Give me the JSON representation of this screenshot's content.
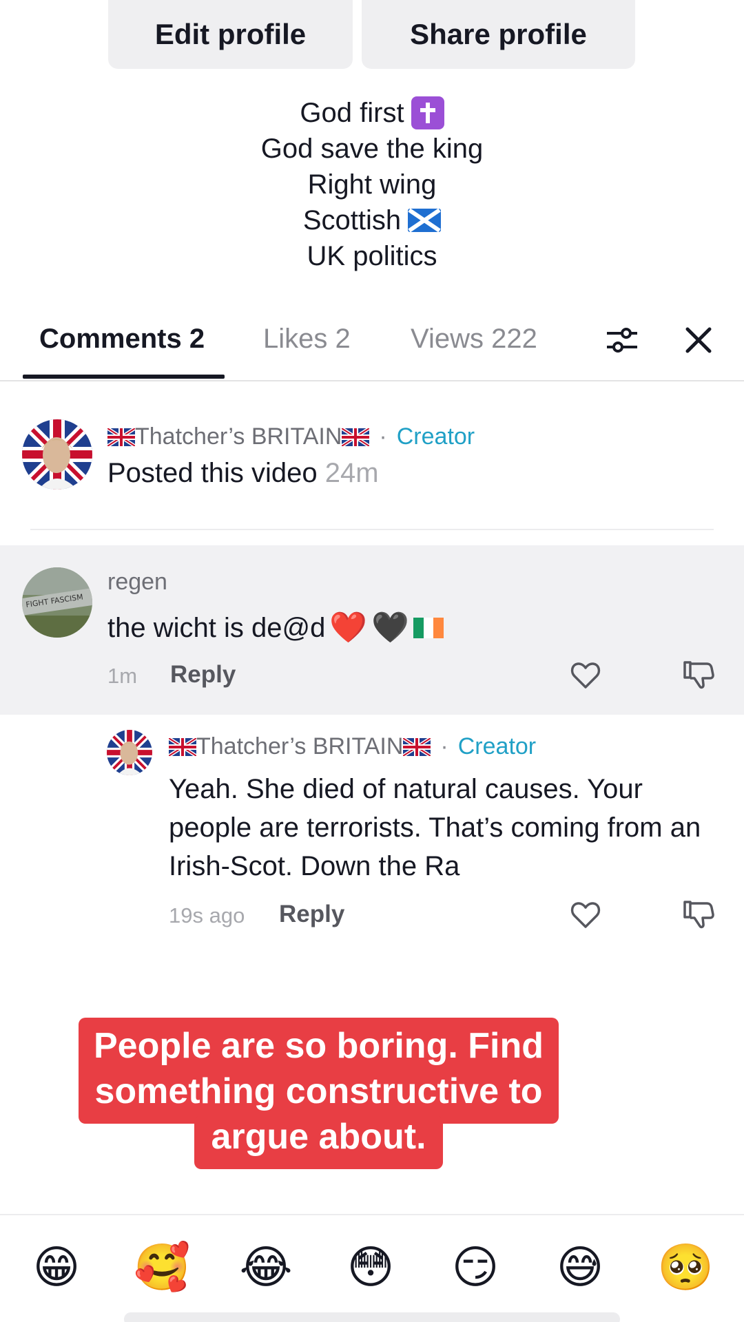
{
  "profile": {
    "edit_label": "Edit profile",
    "share_label": "Share profile",
    "bio_lines": [
      "God first",
      "God save the king",
      "Right wing",
      "Scottish",
      "UK politics"
    ]
  },
  "tabs": [
    {
      "label": "Comments 2",
      "active": true
    },
    {
      "label": "Likes 2",
      "active": false
    },
    {
      "label": "Views 222",
      "active": false
    }
  ],
  "post": {
    "author": "Thatcher’s BRITAIN",
    "creator_label": "Creator",
    "dot": "·",
    "text": "Posted this video",
    "time": "24m"
  },
  "comment": {
    "username": "regen",
    "text": "the wicht is de@d",
    "emojis": [
      "❤️",
      "🖤"
    ],
    "time": "1m",
    "reply_label": "Reply"
  },
  "reply": {
    "author": "Thatcher’s BRITAIN",
    "creator_label": "Creator",
    "dot": "·",
    "text": "Yeah. She died of natural causes. Your people are terrorists. That’s coming from an Irish-Scot. Down the Ra",
    "time": "19s ago",
    "reply_label": "Reply"
  },
  "caption": {
    "text": "People are so boring. Find something constructive to argue about."
  },
  "emoji_bar": [
    "😁",
    "🥰",
    "😂",
    "😳",
    "😏",
    "😅",
    "🥺"
  ],
  "colors": {
    "creator": "#20a0c6",
    "caption_bg": "#e83e44",
    "highlight_bg": "#f1f1f3",
    "cross_badge": "#9b4fd6"
  }
}
